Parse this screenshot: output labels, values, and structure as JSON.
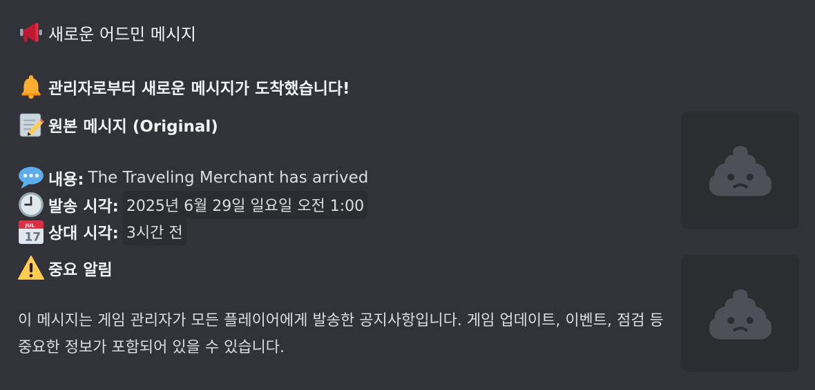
{
  "embed": {
    "header": {
      "icon": "megaphone-icon",
      "title": "새로운 어드민 메시지"
    },
    "alert": {
      "icon": "bell-icon",
      "text": "관리자로부터 새로운 메시지가 도착했습니다!"
    },
    "original": {
      "icon": "memo-icon",
      "text": "원본 메시지 (Original)"
    },
    "fields": {
      "content": {
        "icon": "speech-balloon-icon",
        "label": "내용:",
        "value": "The Traveling Merchant has arrived"
      },
      "sent_time": {
        "icon": "clock-icon",
        "label": "발송 시각:",
        "value": "2025년 6월 29일 일요일 오전 1:00"
      },
      "relative_time": {
        "icon": "calendar-icon",
        "calendar_month": "JUL",
        "calendar_day": "17",
        "label": "상대 시각:",
        "value": "3시간 전"
      }
    },
    "important": {
      "icon": "warning-icon",
      "text": "중요 알림"
    },
    "description": "이 메시지는 게임 관리자가 모든 플레이어에게 발송한 공지사항입니다. 게임 업데이트, 이벤트, 점검 등 중요한 정보가 포함되어 있을 수 있습니다.",
    "images": [
      {
        "icon": "pile-of-poo-icon"
      },
      {
        "icon": "pile-of-poo-icon"
      }
    ],
    "colors": {
      "background": "#313338",
      "code_background": "#2b2d31",
      "placeholder_icon": "#4e5058"
    }
  }
}
